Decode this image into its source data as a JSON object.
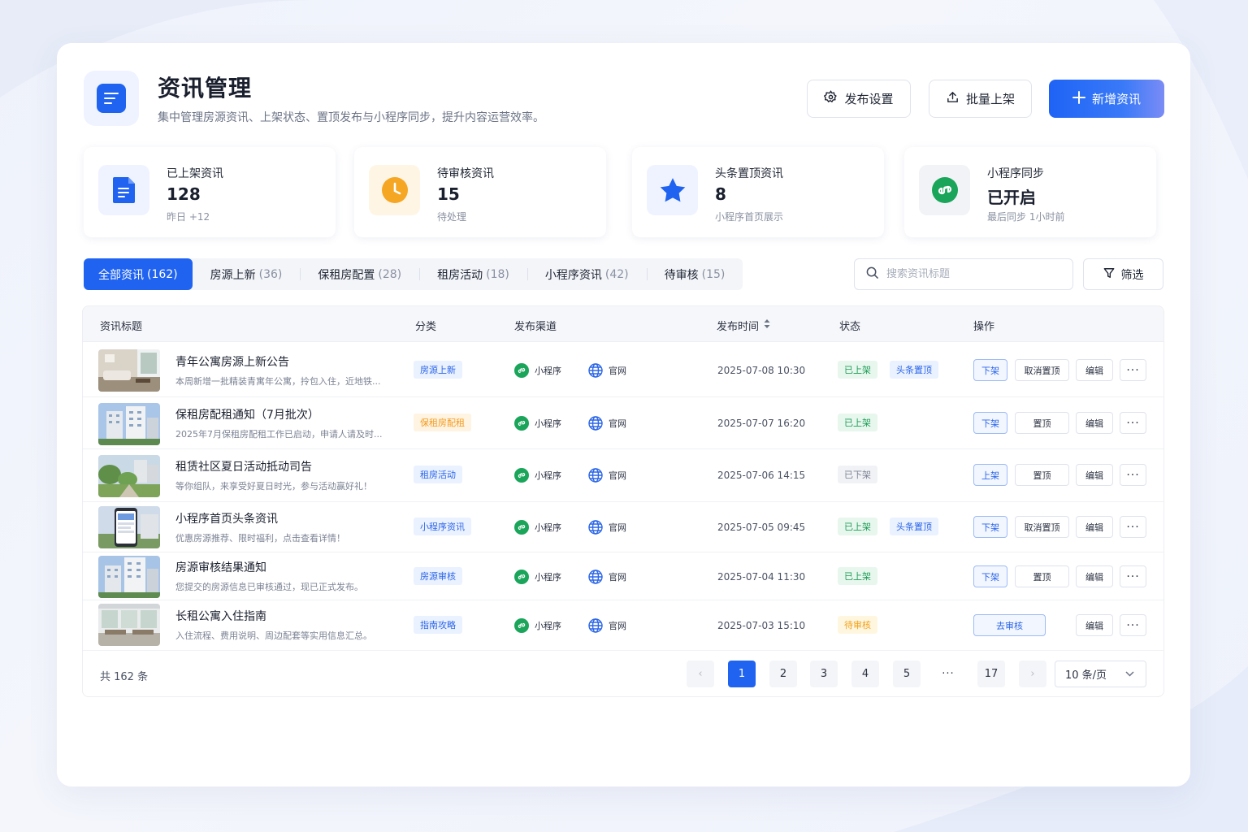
{
  "header": {
    "title": "资讯管理",
    "subtitle": "集中管理房源资讯、上架状态、置顶发布与小程序同步，提升内容运营效率。",
    "buttons": {
      "settings": "发布设置",
      "bulk": "批量上架",
      "add": "新增资讯"
    }
  },
  "stats": [
    {
      "label": "已上架资讯",
      "value": "128",
      "sub": "昨日  +12",
      "icon": "document-icon",
      "color": "#1f63f0"
    },
    {
      "label": "待审核资讯",
      "value": "15",
      "sub": "待处理",
      "icon": "clock-icon",
      "color": "#f5a623"
    },
    {
      "label": "头条置顶资讯",
      "value": "8",
      "sub": "小程序首页展示",
      "icon": "star-icon",
      "color": "#1f63f0"
    },
    {
      "label": "小程序同步",
      "value": "已开启",
      "sub": "最后同步   1小时前",
      "icon": "mini-program-icon",
      "color": "#1aa55a"
    }
  ],
  "tabs": [
    {
      "label": "全部资讯",
      "count": "(162)"
    },
    {
      "label": "房源上新",
      "count": "(36)"
    },
    {
      "label": "保租房配置",
      "count": "(28)"
    },
    {
      "label": "租房活动",
      "count": "(18)"
    },
    {
      "label": "小程序资讯",
      "count": "(42)"
    },
    {
      "label": "待审核",
      "count": "(15)"
    }
  ],
  "search": {
    "placeholder": "搜索资讯标题"
  },
  "filter_label": "筛选",
  "table": {
    "headers": {
      "title": "资讯标题",
      "category": "分类",
      "channel": "发布渠道",
      "time": "发布时间",
      "status": "状态",
      "action": "操作"
    },
    "rows": [
      {
        "title": "青年公寓房源上新公告",
        "desc": "本周新增一批精装青寓年公寓，拎包入住，近地铁...",
        "category": "房源上新",
        "cat_style": "blue",
        "ch1": "小程序",
        "ch2": "官网",
        "time": "2025-07-08  10:30",
        "status": "已上架",
        "status_style": "green",
        "top": "头条置顶",
        "act1": "下架",
        "act2": "取消置顶",
        "edit": "编辑",
        "more": "···"
      },
      {
        "title": "保租房配租通知（7月批次）",
        "desc": "2025年7月保租房配租工作已启动，申请人请及时...",
        "category": "保租房配租",
        "cat_style": "orange",
        "ch1": "小程序",
        "ch2": "官网",
        "time": "2025-07-07  16:20",
        "status": "已上架",
        "status_style": "green",
        "top": "",
        "act1": "下架",
        "act2": "置顶",
        "edit": "编辑",
        "more": "···"
      },
      {
        "title": "租赁社区夏日活动抵动司告",
        "desc": "等你组队，来享受好夏日时光，参与活动赢好礼！",
        "category": "租房活动",
        "cat_style": "blue",
        "ch1": "小程序",
        "ch2": "官网",
        "time": "2025-07-06  14:15",
        "status": "已下架",
        "status_style": "gray",
        "top": "",
        "act1": "上架",
        "act2": "置顶",
        "edit": "编辑",
        "more": "···"
      },
      {
        "title": "小程序首页头条资讯",
        "desc": "优惠房源推荐、限时福利，点击查看详情！",
        "category": "小程序资讯",
        "cat_style": "blue",
        "ch1": "小程序",
        "ch2": "官网",
        "time": "2025-07-05 09:45",
        "status": "已上架",
        "status_style": "green",
        "top": "头条置顶",
        "act1": "下架",
        "act2": "取消置顶",
        "edit": "编辑",
        "more": "···"
      },
      {
        "title": "房源审核结果通知",
        "desc": "您提交的房源信息已审核通过，现已正式发布。",
        "category": "房源审核",
        "cat_style": "blue",
        "ch1": "小程序",
        "ch2": "官网",
        "time": "2025-07-04  11:30",
        "status": "已上架",
        "status_style": "green",
        "top": "",
        "act1": "下架",
        "act2": "置顶",
        "edit": "编辑",
        "more": "···"
      },
      {
        "title": "长租公寓入住指南",
        "desc": "入住流程、费用说明、周边配套等实用信息汇总。",
        "category": "指南攻略",
        "cat_style": "blue",
        "ch1": "小程序",
        "ch2": "官网",
        "time": "2025-07-03  15:10",
        "status": "待审核",
        "status_style": "yellow",
        "top": "",
        "act1": "去审核",
        "act2": "",
        "edit": "编辑",
        "more": "···"
      }
    ]
  },
  "pagination": {
    "total": "共 162 条",
    "prev": "‹",
    "next": "›",
    "pages": [
      "1",
      "2",
      "3",
      "4",
      "5",
      "···",
      "17"
    ],
    "page_size": "10 条/页"
  }
}
